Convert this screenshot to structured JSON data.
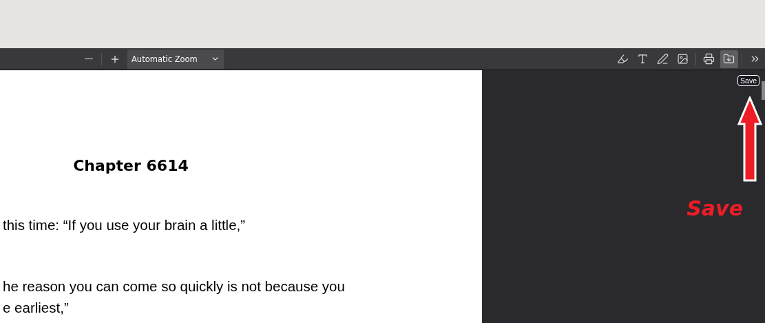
{
  "toolbar": {
    "zoom": {
      "value": "Automatic Zoom"
    },
    "tools": [
      {
        "kind": "highlight",
        "highlighted": false
      },
      {
        "kind": "text",
        "highlighted": false
      },
      {
        "kind": "draw",
        "highlighted": false
      },
      {
        "kind": "image",
        "highlighted": false
      },
      {
        "kind": "divider"
      },
      {
        "kind": "print",
        "highlighted": false
      },
      {
        "kind": "save",
        "highlighted": true
      },
      {
        "kind": "divider"
      },
      {
        "kind": "more",
        "highlighted": false
      }
    ]
  },
  "tooltip": "Save",
  "document": {
    "heading": "Chapter 6614",
    "paragraphs": [
      "this time: “If you use your brain a little,”",
      "he reason you can come so quickly is not because you\ne earliest,”"
    ]
  },
  "annotation": {
    "label": "Save"
  }
}
